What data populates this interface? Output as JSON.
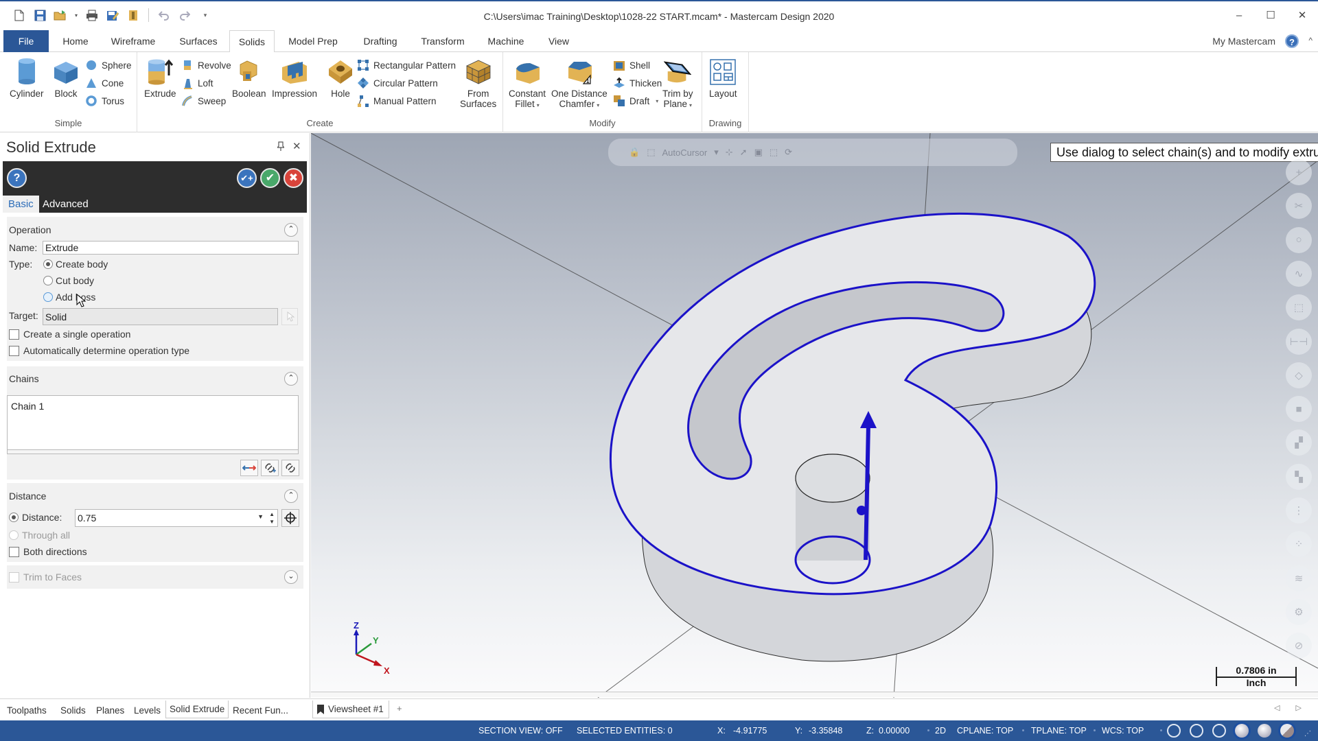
{
  "window": {
    "title": "C:\\Users\\imac Training\\Desktop\\1028-22 START.mcam* - Mastercam Design 2020",
    "minimize": "–",
    "maximize": "☐",
    "close": "✕"
  },
  "quick_access": [
    {
      "name": "new-file",
      "icon": "new-file-icon"
    },
    {
      "name": "save",
      "icon": "save-icon"
    },
    {
      "name": "open",
      "icon": "open-folder-icon"
    },
    {
      "name": "print",
      "icon": "print-icon"
    },
    {
      "name": "save-as",
      "icon": "save-as-icon"
    },
    {
      "name": "properties",
      "icon": "file-properties-icon"
    },
    {
      "name": "undo",
      "icon": "undo-icon"
    },
    {
      "name": "redo",
      "icon": "redo-icon"
    },
    {
      "name": "customize",
      "icon": "customize-dropdown-icon"
    }
  ],
  "ribbon_tabs": [
    "File",
    "Home",
    "Wireframe",
    "Surfaces",
    "Solids",
    "Model Prep",
    "Drafting",
    "Transform",
    "Machine",
    "View"
  ],
  "active_ribbon_tab": "Solids",
  "my_mastercam": "My Mastercam",
  "help_glyph": "?",
  "collapse_glyph": "^",
  "ribbon": {
    "groups": {
      "simple": "Simple",
      "create": "Create",
      "modify": "Modify",
      "drawing": "Drawing"
    },
    "simple": {
      "cylinder": "Cylinder",
      "block": "Block",
      "sphere": "Sphere",
      "cone": "Cone",
      "torus": "Torus"
    },
    "create": {
      "extrude": "Extrude",
      "revolve": "Revolve",
      "loft": "Loft",
      "sweep": "Sweep",
      "boolean": "Boolean",
      "impression": "Impression",
      "hole": "Hole",
      "rectangular_pattern": "Rectangular Pattern",
      "circular_pattern": "Circular Pattern",
      "manual_pattern": "Manual Pattern",
      "from_surfaces_1": "From",
      "from_surfaces_2": "Surfaces"
    },
    "modify": {
      "constant_fillet_1": "Constant",
      "constant_fillet_2": "Fillet",
      "one_distance_chamfer_1": "One Distance",
      "one_distance_chamfer_2": "Chamfer",
      "shell": "Shell",
      "thicken": "Thicken",
      "draft": "Draft",
      "trim_by_plane_1": "Trim by",
      "trim_by_plane_2": "Plane"
    },
    "drawing": {
      "layout": "Layout"
    },
    "dropdown_glyph": "▾"
  },
  "panel": {
    "title": "Solid Extrude",
    "pin_glyph": "📌",
    "close_glyph": "✕",
    "buttons": {
      "help": "?",
      "ok_new": "✔+",
      "ok": "✔",
      "cancel": "✖"
    },
    "tabs": [
      "Basic",
      "Advanced"
    ],
    "active_tab": "Basic",
    "operation": {
      "title": "Operation",
      "name_label": "Name:",
      "name_value": "Extrude",
      "type_label": "Type:",
      "types": [
        {
          "label": "Create body",
          "checked": true
        },
        {
          "label": "Cut body",
          "checked": false
        },
        {
          "label": "Add boss",
          "checked": false
        }
      ],
      "target_label": "Target:",
      "target_value": "Solid",
      "create_single_operation": "Create a single operation",
      "create_single_operation_checked": false,
      "auto_determine_type": "Automatically determine operation type",
      "auto_determine_type_checked": false
    },
    "chains": {
      "title": "Chains",
      "items": [
        "Chain  1"
      ],
      "buttons": [
        "reverse-chain",
        "add-chain",
        "rechain"
      ]
    },
    "distance": {
      "title": "Distance",
      "distance_label": "Distance:",
      "distance_value": "0.75",
      "distance_selected": true,
      "through_all": "Through all",
      "both_directions": "Both directions",
      "both_directions_checked": false
    },
    "trim_to_faces": {
      "label": "Trim to Faces",
      "checked": false,
      "enabled": false
    },
    "toggle_up": "⌃",
    "toggle_down": "⌄"
  },
  "viewport": {
    "autocursor_label": "AutoCursor",
    "prompt": "Use dialog to select chain(s) and to modify extrusion parameters",
    "gnomon": {
      "x": "X",
      "y": "Y",
      "z": "Z"
    },
    "scale_value": "0.7806 in",
    "scale_unit": "Inch",
    "colors": {
      "chain": "#1b12c8",
      "axis_x": "#c0151d",
      "axis_y": "#2a9a3a",
      "axis_z": "#1a1ab8"
    },
    "right_toolbar": [
      "add-icon",
      "trim-icon",
      "circle-icon",
      "spline-icon",
      "wireframe-box-icon",
      "dimension-icon",
      "sweep-tool-icon",
      "solid-icon",
      "move-to-level-icon",
      "copy-to-level-icon",
      "analyze-icon",
      "points-icon",
      "levels-icon",
      "settings-gear-icon",
      "cancel-icon"
    ]
  },
  "bottom_tabs": [
    "Toolpaths",
    "Solids",
    "Planes",
    "Levels",
    "Solid Extrude",
    "Recent Fun..."
  ],
  "active_bottom_tab": "Solid Extrude",
  "viewsheet": "Viewsheet #1",
  "viewsheet_add": "+",
  "viewsheet_nav": "◁ ▷",
  "status": {
    "section_view": "SECTION VIEW: OFF",
    "selected_entities": "SELECTED ENTITIES: 0",
    "x_label": "X:",
    "x_value": "-4.91775",
    "y_label": "Y:",
    "y_value": "-3.35848",
    "z_label": "Z:",
    "z_value": "0.00000",
    "mode": "2D",
    "cplane": "CPLANE: TOP",
    "tplane": "TPLANE: TOP",
    "wcs": "WCS: TOP",
    "brand_color": "#2b5797"
  }
}
